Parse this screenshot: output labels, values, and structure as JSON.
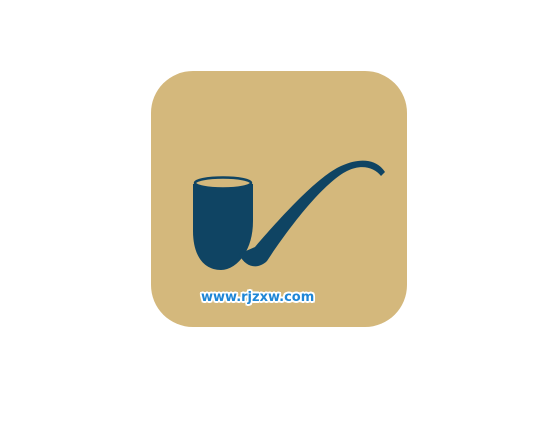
{
  "icon": {
    "name": "pipe-icon",
    "background_color": "#d4b87c",
    "pipe_color": "#0f4463",
    "bowl_rim_color": "#d4b87c"
  },
  "watermark": {
    "text": "www.rjzxw.com",
    "color": "#1f86d6",
    "outline_color": "#ffffff"
  }
}
